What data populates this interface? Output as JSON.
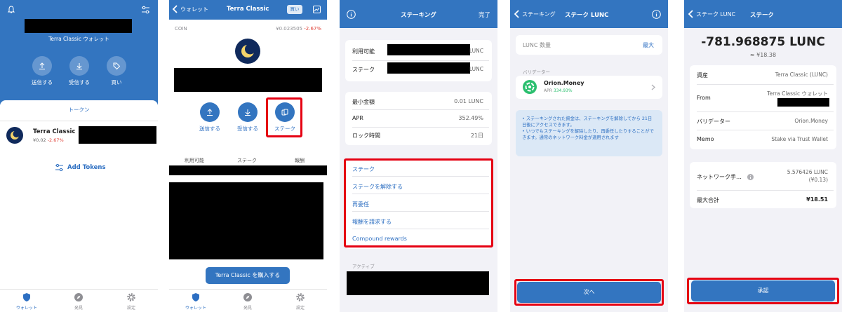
{
  "panel1": {
    "wallet_name": "Terra Classic ウォレット",
    "actions": [
      {
        "label": "送信する",
        "icon": "arrow-up-icon"
      },
      {
        "label": "受信する",
        "icon": "arrow-down-icon"
      },
      {
        "label": "買い",
        "icon": "tag-icon"
      }
    ],
    "tokens_tab": "トークン",
    "token": {
      "name": "Terra Classic",
      "price": "¥0.02",
      "change": "-2.67%"
    },
    "add_tokens": "Add Tokens",
    "tabs": [
      {
        "label": "ウォレット",
        "active": true
      },
      {
        "label": "発見",
        "active": false
      },
      {
        "label": "設定",
        "active": false
      }
    ]
  },
  "panel2": {
    "back_label": "ウォレット",
    "title": "Terra Classic",
    "buy_badge": "買い",
    "coin_label": "COIN",
    "price": "¥0.023505",
    "change": "-2.67%",
    "actions": [
      {
        "label": "送信する"
      },
      {
        "label": "受信する"
      },
      {
        "label": "ステーク"
      }
    ],
    "columns": [
      "利用可能",
      "ステーク",
      "報酬"
    ],
    "buy_button": "Terra Classic を購入する",
    "tabs": [
      {
        "label": "ウォレット",
        "active": true
      },
      {
        "label": "発見",
        "active": false
      },
      {
        "label": "設定",
        "active": false
      }
    ]
  },
  "panel3": {
    "title": "ステーキング",
    "done": "完了",
    "balances": [
      {
        "label": "利用可能",
        "unit": "LUNC"
      },
      {
        "label": "ステーク",
        "unit": "LUNC"
      }
    ],
    "info": [
      {
        "label": "最小金額",
        "value": "0.01 LUNC"
      },
      {
        "label": "APR",
        "value": "352.49%"
      },
      {
        "label": "ロック時間",
        "value": "21日"
      }
    ],
    "menu": [
      "ステーク",
      "ステークを解除する",
      "再委任",
      "報酬を請求する",
      "Compound rewards"
    ],
    "active_label": "アクティブ"
  },
  "panel4": {
    "back_label": "ステーキング",
    "title": "ステーク LUNC",
    "amount_label": "LUNC 数量",
    "max": "最大",
    "validator_header": "バリデーター",
    "validator_name": "Orion.Money",
    "validator_apr_label": "APR",
    "validator_apr": "334.93%",
    "notes": [
      "• ステーキングされた資金は、ステーキングを解除してから 21日 日後にアクセスできます。",
      "• いつでもステーキングを解除したり、再委任したりすることができます。通常のネットワーク料金が適用されます"
    ],
    "next_button": "次へ"
  },
  "panel5": {
    "back_label": "ステーク LUNC",
    "title": "ステーク",
    "amount": "-781.968875 LUNC",
    "fiat": "≈ ¥18.38",
    "details": [
      {
        "label": "資産",
        "value": "Terra Classic (LUNC)"
      },
      {
        "label": "From",
        "value": "Terra Classic ウォレット"
      },
      {
        "label": "バリデーター",
        "value": "Orion.Money"
      },
      {
        "label": "Memo",
        "value": "Stake via Trust Wallet"
      }
    ],
    "fee_label": "ネットワーク手…",
    "fee_value": "5.576426 LUNC",
    "fee_fiat": "(¥0.13)",
    "total_label": "最大合計",
    "total_value": "¥18.51",
    "confirm_button": "承認"
  },
  "colors": {
    "accent": "#3375c0",
    "negative": "#e0443a",
    "highlight": "#e50012"
  }
}
